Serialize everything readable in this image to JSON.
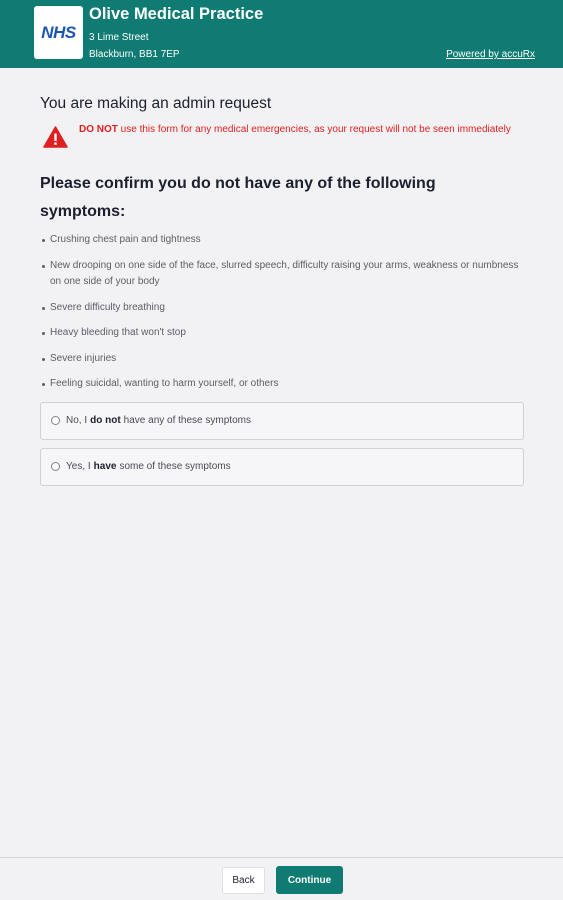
{
  "header": {
    "logo_text": "NHS",
    "practice_name": "Olive Medical Practice",
    "address_line1": "3 Lime Street",
    "address_line2": "Blackburn, BB1 7EP",
    "powered_by": "Powered by accuRx",
    "background_color": "#0f7b73"
  },
  "main": {
    "title": "You are making an admin request",
    "warning": {
      "icon": "warning-triangle-icon",
      "bold": "DO NOT",
      "text": " use this form for any medical emergencies, as your request will not be seen immediately",
      "color": "#e02020"
    },
    "question": "Please confirm you do not have any of the following symptoms:",
    "symptoms": [
      "Crushing chest pain and tightness",
      "New drooping on one side of the face, slurred speech, difficulty raising your arms, weakness or numbness on one side of your body",
      "Severe difficulty breathing",
      "Heavy bleeding that won't stop",
      "Severe injuries",
      "Feeling suicidal, wanting to harm yourself, or others"
    ],
    "options": [
      {
        "pre": "No, I",
        "bold": "do not",
        "post": "have any of these symptoms"
      },
      {
        "pre": "Yes, I",
        "bold": "have",
        "post": "some of these symptoms"
      }
    ]
  },
  "footer": {
    "back_label": "Back",
    "continue_label": "Continue",
    "accent_color": "#0f7b73"
  }
}
